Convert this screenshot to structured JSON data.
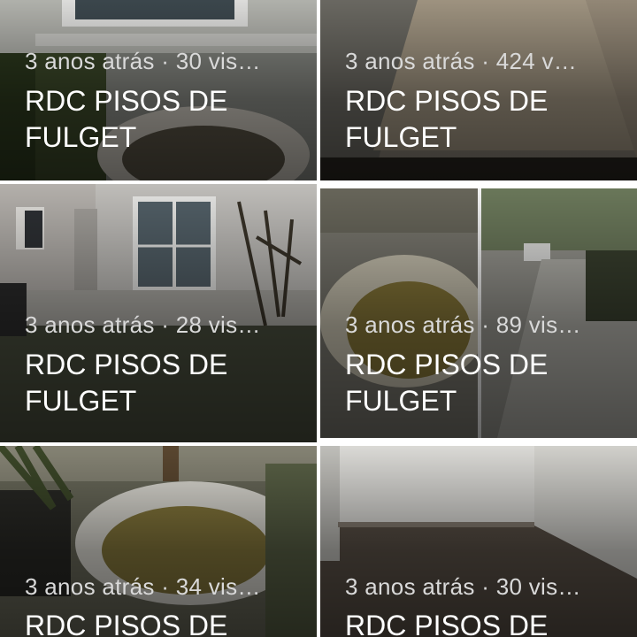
{
  "videos": [
    {
      "meta": "3 anos atrás · 30 vis…",
      "title": "RDC PISOS DE FULGET"
    },
    {
      "meta": "3 anos atrás · 424 v…",
      "title": "RDC PISOS DE FULGET"
    },
    {
      "meta": "3 anos atrás · 28 vis…",
      "title": "RDC PISOS DE FULGET"
    },
    {
      "meta": "3 anos atrás · 89 vis…",
      "title": "RDC PISOS DE FULGET"
    },
    {
      "meta": "3 anos atrás · 34 vis…",
      "title": "RDC PISOS DE"
    },
    {
      "meta": "3 anos atrás · 30 vis…",
      "title": "RDC PISOS DE"
    }
  ]
}
